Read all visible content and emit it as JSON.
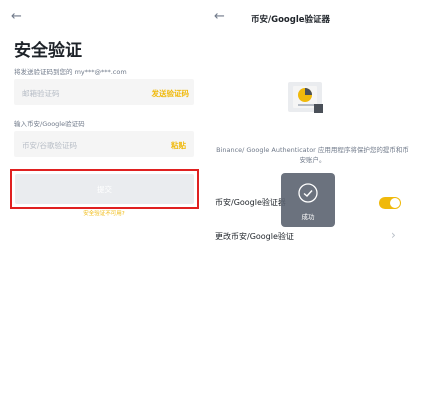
{
  "left": {
    "back_glyph": "←",
    "title": "安全验证",
    "email_hint": "将发送验证码到您的 my***@***.com",
    "email_placeholder": "邮箱验证码",
    "send_code": "发送验证码",
    "google_label": "输入币安/Google验证码",
    "google_placeholder": "币安/谷歌验证码",
    "paste": "粘贴",
    "submit": "提交",
    "unavailable": "安全验证不可用?"
  },
  "right": {
    "back_glyph": "←",
    "title": "币安/Google验证器",
    "description": "Binance/ Google Authenticator 应用用程序将保护您的提币和币安账户。",
    "row1_label": "币安/Google验证器",
    "row2_label": "更改币安/Google验证",
    "chevron": "›"
  },
  "toast": {
    "text": "成功"
  },
  "colors": {
    "accent": "#f0b90b",
    "highlight": "#e02020"
  }
}
